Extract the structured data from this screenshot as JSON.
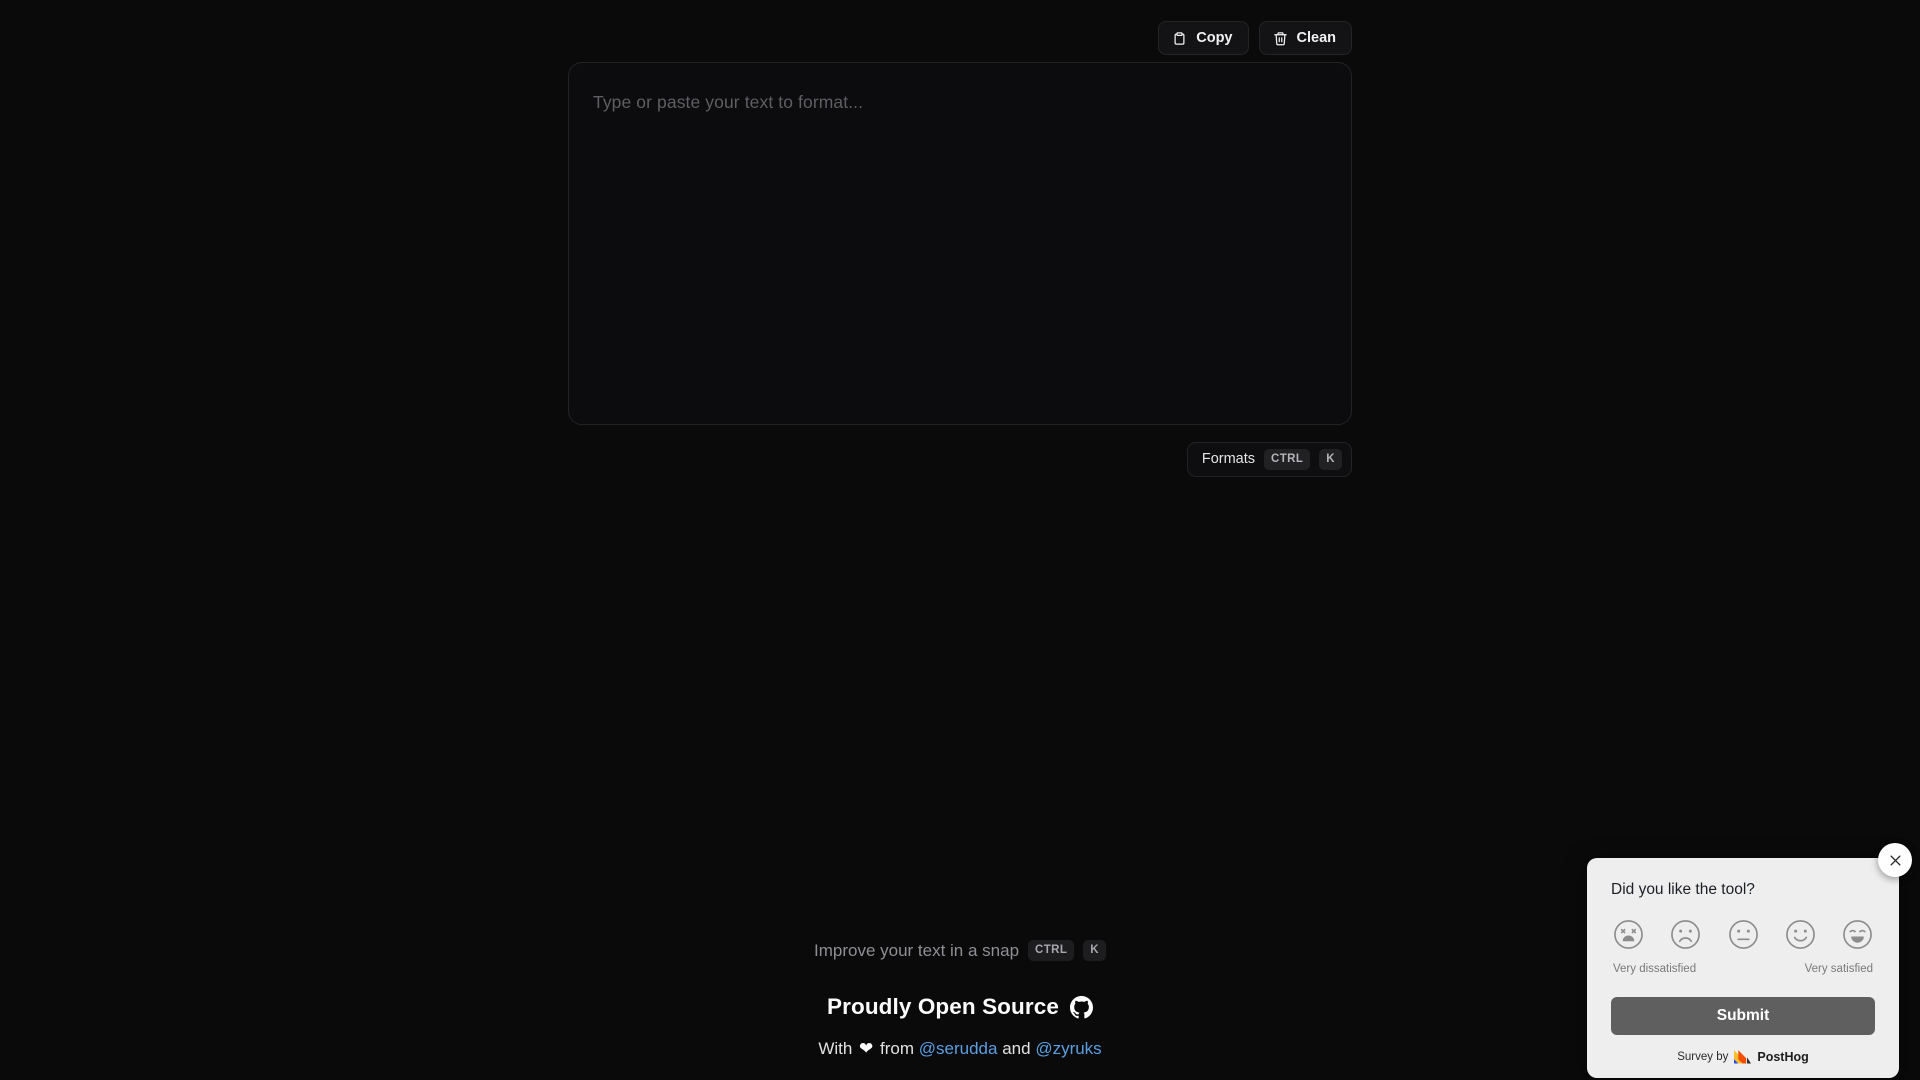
{
  "toolbar": {
    "copy_label": "Copy",
    "clean_label": "Clean"
  },
  "editor": {
    "placeholder": "Type or paste your text to format...",
    "value": ""
  },
  "formats": {
    "label": "Formats",
    "shortcut_modifier": "CTRL",
    "shortcut_key": "K"
  },
  "footer": {
    "tagline": "Improve your text in a snap",
    "shortcut_modifier": "CTRL",
    "shortcut_key": "K",
    "open_source_title": "Proudly Open Source",
    "credits_prefix": "With",
    "credits_heart": "❤",
    "credits_from": "from",
    "credits_author_1": "@serudda",
    "credits_and": "and",
    "credits_author_2": "@zyruks"
  },
  "survey": {
    "question": "Did you like the tool?",
    "ratings": [
      {
        "value": 1,
        "face": "very-dissatisfied"
      },
      {
        "value": 2,
        "face": "dissatisfied"
      },
      {
        "value": 3,
        "face": "neutral"
      },
      {
        "value": 4,
        "face": "satisfied"
      },
      {
        "value": 5,
        "face": "very-satisfied"
      }
    ],
    "low_label": "Very dissatisfied",
    "high_label": "Very satisfied",
    "submit_label": "Submit",
    "attribution_prefix": "Survey by",
    "attribution_brand": "PostHog"
  },
  "colors": {
    "background": "#0a0a0b",
    "panel_border": "#232326",
    "link": "#5b9fe0",
    "survey_background": "#eeeeee",
    "submit_background": "#5f5f5f"
  }
}
